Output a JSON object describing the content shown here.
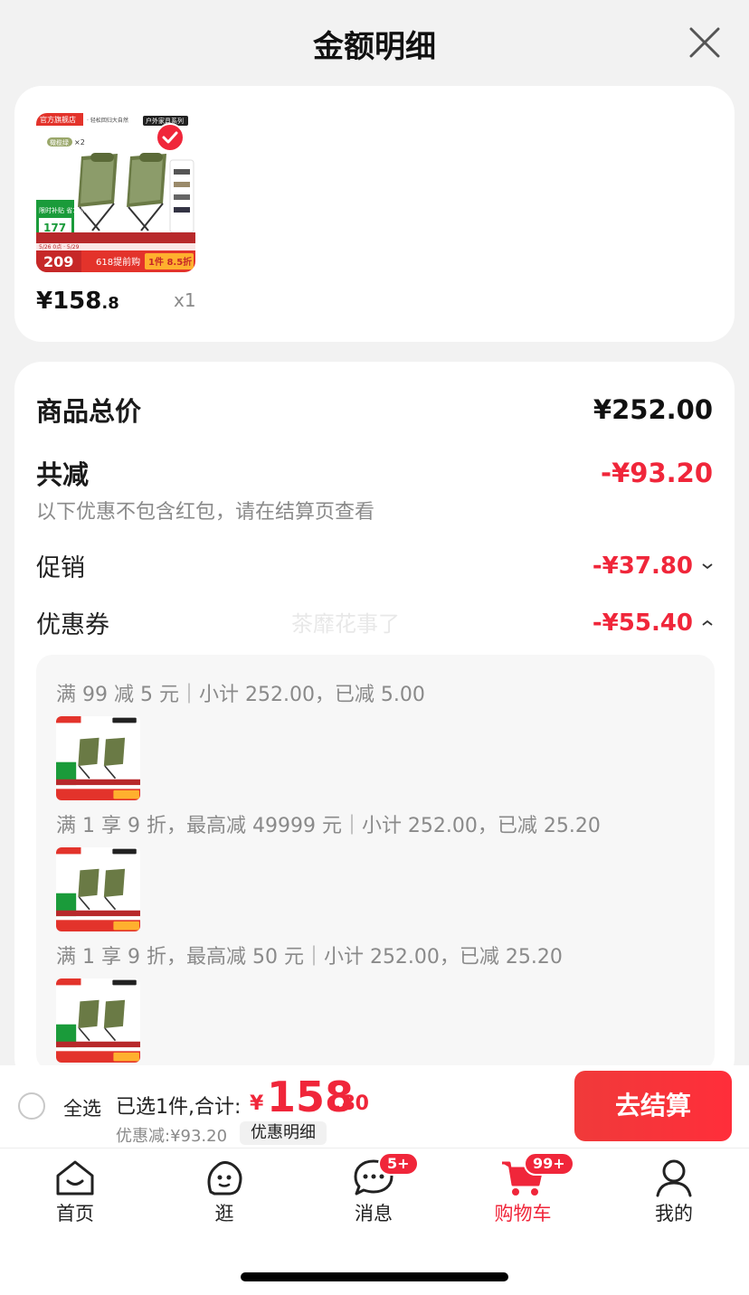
{
  "header": {
    "title": "金额明细"
  },
  "product": {
    "image": {
      "store_tag": "官方旗舰店",
      "tagline": "· 轻松回归大自然",
      "series_tag": "户外家具系列",
      "color_tag": "橄榄绿",
      "multiplier": "×2",
      "promo_text": "限时补贴 省15%",
      "promo_price": "177",
      "date_text": "5/26 0点 · 5/29",
      "big_price": "209",
      "banner_text": "618提前购",
      "banner_deal": "1件 8.5折"
    },
    "price_main": "¥158",
    "price_decimal": ".8",
    "quantity": "x1"
  },
  "summary": {
    "total_label": "商品总价",
    "total_value": "¥252.00",
    "reduce_label": "共减",
    "reduce_value": "-¥93.20",
    "reduce_note": "以下优惠不包含红包，请在结算页查看",
    "promo_label": "促销",
    "promo_value": "-¥37.80",
    "coupon_label": "优惠券",
    "coupon_value": "-¥55.40",
    "watermark": "茶靡花事了"
  },
  "coupons": [
    {
      "text": "满 99 减 5 元｜小计 252.00，已减 5.00"
    },
    {
      "text": "满 1 享 9 折，最高减 49999 元｜小计 252.00，已减 25.20"
    },
    {
      "text": "满 1 享 9 折，最高减 50 元｜小计 252.00，已减 25.20"
    }
  ],
  "bottom_bar": {
    "select_all": "全选",
    "selected_text": "已选1件,合计:",
    "currency": "¥",
    "total_int": "158",
    "total_dec": ".80",
    "discount_text": "优惠减:¥93.20",
    "detail_button": "优惠明细",
    "checkout": "去结算"
  },
  "tabs": [
    {
      "label": "首页",
      "icon": "home-icon"
    },
    {
      "label": "逛",
      "icon": "explore-face-icon"
    },
    {
      "label": "消息",
      "icon": "message-icon",
      "badge": "5+"
    },
    {
      "label": "购物车",
      "icon": "cart-icon",
      "badge": "99+",
      "active": true
    },
    {
      "label": "我的",
      "icon": "profile-icon"
    }
  ],
  "colors": {
    "accent": "#f0263a",
    "product_green": "#6a7a45"
  }
}
